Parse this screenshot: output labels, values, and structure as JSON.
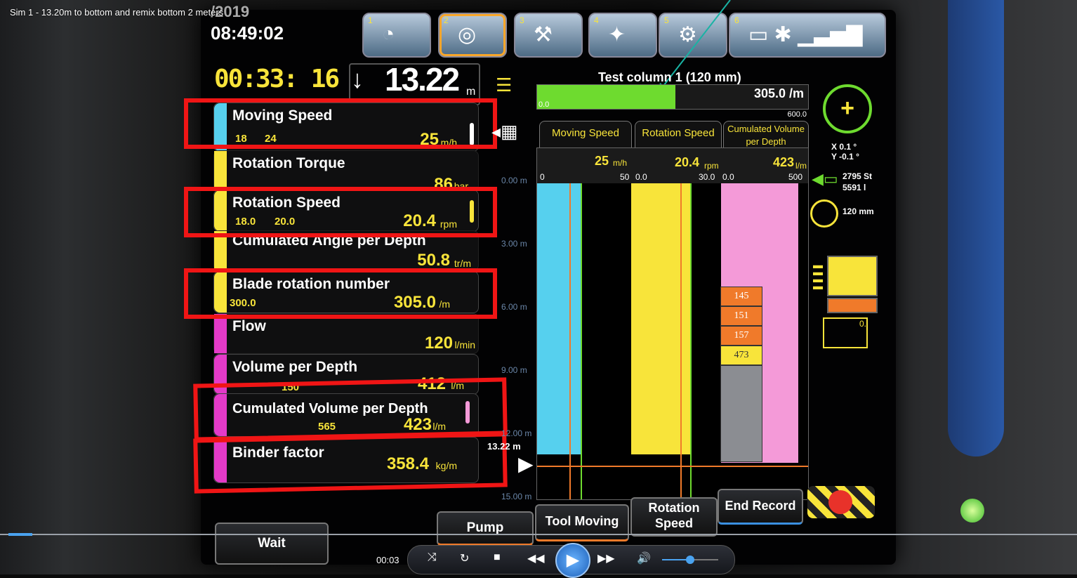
{
  "window": {
    "title": "Sim 1 - 13.20m to bottom and remix bottom 2 meters"
  },
  "header": {
    "date": "/2019",
    "clock": "08:49:02",
    "timer": "00:33: 16",
    "depth_value": "13.22",
    "depth_unit": "m",
    "toolbar": [
      {
        "num": "1",
        "icon": "pie-chart-icon"
      },
      {
        "num": "2",
        "icon": "target-icon"
      },
      {
        "num": "3",
        "icon": "tool-icon"
      },
      {
        "num": "4",
        "icon": "compass-icon"
      },
      {
        "num": "5",
        "icon": "gear-icon"
      },
      {
        "num": "6",
        "icon": "device-icon"
      }
    ]
  },
  "panel": {
    "moving_speed": {
      "label": "Moving Speed",
      "set1": "18",
      "set2": "24",
      "value": "25",
      "unit": "m/h"
    },
    "rotation_torque": {
      "label": "Rotation Torque",
      "value": "86",
      "unit": "bar"
    },
    "rotation_speed": {
      "label": "Rotation Speed",
      "set1": "18.0",
      "set2": "20.0",
      "value": "20.4",
      "unit": "rpm"
    },
    "cumulated_angle": {
      "label": "Cumulated Angle per Depth",
      "value": "50.8",
      "unit": "tr/m"
    },
    "blade_rotation": {
      "label": "Blade rotation number",
      "set1": "300.0",
      "value": "305.0",
      "unit": "/m"
    },
    "flow": {
      "label": "Flow",
      "value": "120",
      "unit": "l/min"
    },
    "volume_per_depth": {
      "label": "Volume per Depth",
      "set1": "150",
      "value": "412",
      "unit": "l/m"
    },
    "cumulated_volume": {
      "label": "Cumulated Volume per Depth",
      "set1": "565",
      "value": "423",
      "unit": "l/m"
    },
    "binder_factor": {
      "label": "Binder factor",
      "value": "358.4",
      "unit": "kg/m"
    }
  },
  "gauge": {
    "title": "Test column 1 (120 mm)",
    "value": "305.0 /m",
    "min": "0.0",
    "max": "600.0",
    "fraction": 0.51
  },
  "chart_tabs": [
    "Moving Speed",
    "Rotation Speed",
    "Cumulated Volume per Depth"
  ],
  "chart_head": {
    "ms_value": "25",
    "ms_unit": "m/h",
    "ms_min": "0",
    "ms_max": "50",
    "rs_value": "20.4",
    "rs_unit": "rpm",
    "rs_min": "0.0",
    "rs_max": "30.0",
    "cv_value": "423",
    "cv_unit": "l/m",
    "cv_min": "0.0",
    "cv_max": "500"
  },
  "depth_axis": [
    "0.00 m",
    "3.00 m",
    "6.00 m",
    "9.00 m",
    "12.00 m",
    "15.00 m"
  ],
  "current_depth": "13.22 m",
  "volume_cells": [
    "145",
    "151",
    "157",
    "473"
  ],
  "right_panel": {
    "x": "X 0.1 °",
    "y": "Y -0.1 °",
    "count1": "2795 St",
    "count2": "5591 l",
    "diameter": "120 mm",
    "small": "0."
  },
  "buttons": {
    "wait": "Wait",
    "pump": "Pump",
    "tool_moving": "Tool Moving",
    "rotation_speed": "Rotation Speed",
    "end_record": "End Record"
  },
  "player": {
    "time": "00:03"
  },
  "colors": {
    "cyan": "#56d0ee",
    "yellow": "#f8e43a",
    "magenta": "#e43ac8",
    "pink": "#f49ad8",
    "red": "#f01515",
    "green": "#6edb2f",
    "orange": "#f07a2a"
  }
}
